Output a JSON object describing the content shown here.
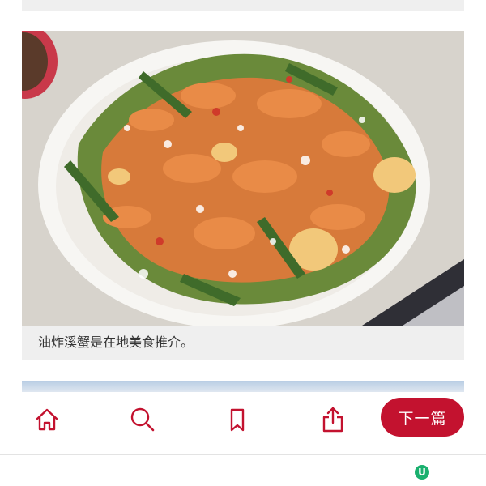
{
  "article": {
    "photo_alt": "油炸溪蟹",
    "caption": "油炸溪蟹是在地美食推介。"
  },
  "toolbar": {
    "home_icon": "home-icon",
    "search_icon": "search-icon",
    "bookmark_icon": "bookmark-icon",
    "share_icon": "share-icon",
    "next_label": "下一篇"
  },
  "system_bar": {
    "badge_letter": "U",
    "badge_icon": "u-app-icon"
  },
  "colors": {
    "accent": "#c3122f",
    "caption_bg": "#efefef",
    "badge": "#19b06e"
  }
}
